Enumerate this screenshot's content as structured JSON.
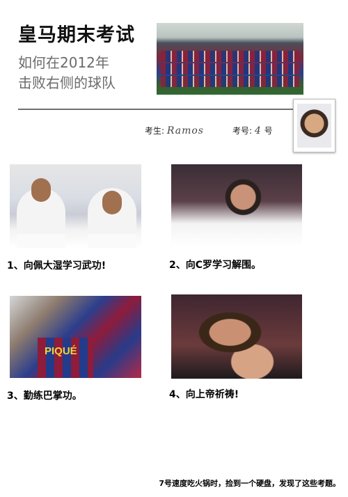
{
  "header": {
    "title": "皇马期末考试",
    "subtitle_line1": "如何在2012年",
    "subtitle_line2": "击败右侧的球队"
  },
  "exam_info": {
    "candidate_label": "考生:",
    "candidate_value": "Ramos",
    "number_label": "考号:",
    "number_value": "4",
    "number_suffix": "号"
  },
  "questions": [
    {
      "label": "1、向佩大湿学习武功!"
    },
    {
      "label": "2、向C罗学习解围。"
    },
    {
      "label": "3、勤练巴掌功。"
    },
    {
      "label": "4、向上帝祈祷!"
    }
  ],
  "jersey_text": "PIQUÉ",
  "footer": "7号速度吃火锅时，捡到一个硬盘，发现了这些考题。"
}
